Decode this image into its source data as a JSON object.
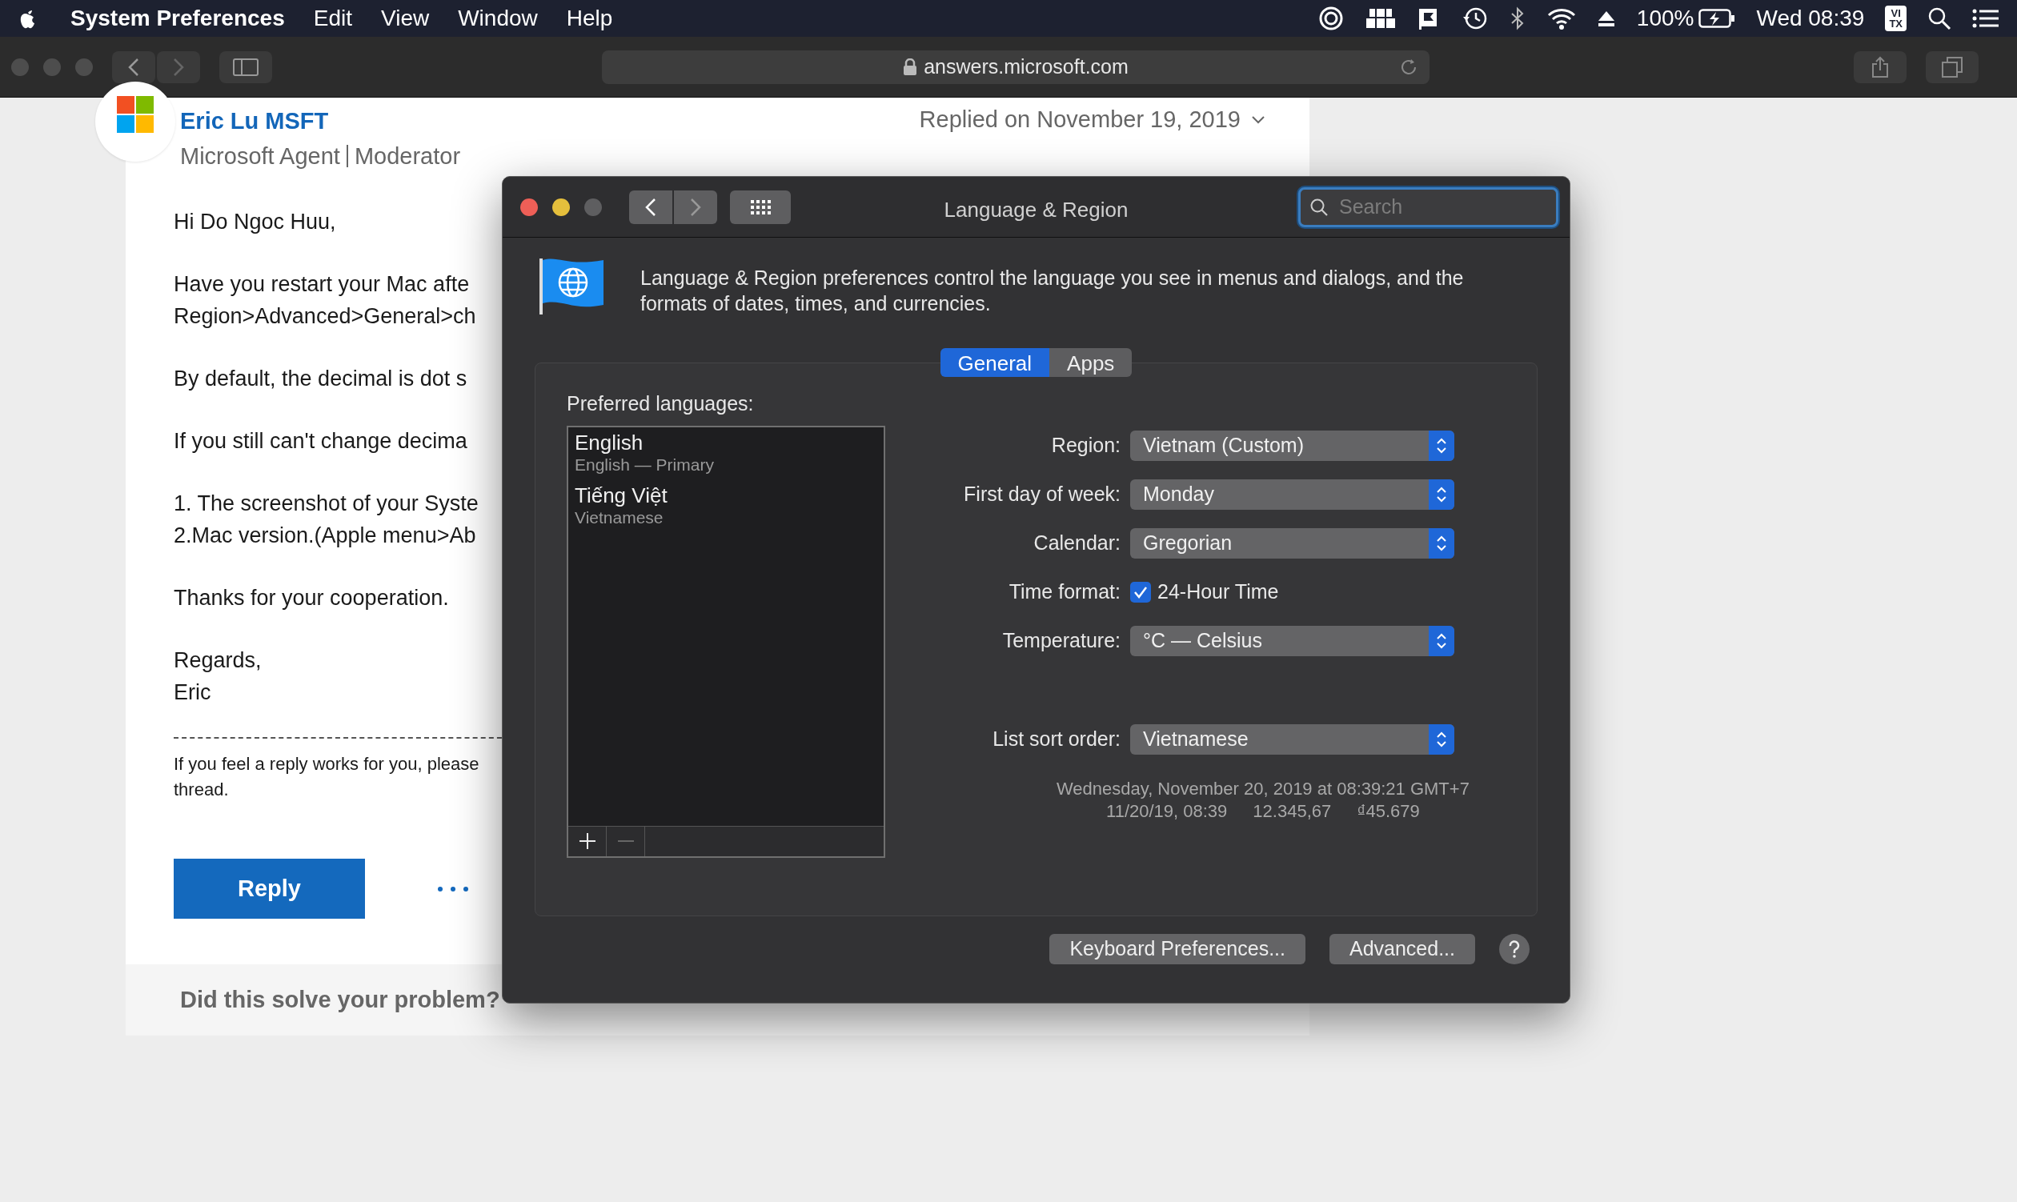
{
  "menu_bar": {
    "app": "System Preferences",
    "menus": [
      "Edit",
      "View",
      "Window",
      "Help"
    ],
    "battery": "100%",
    "clock": "Wed 08:39",
    "input_source": [
      "VI",
      "TX"
    ]
  },
  "browser": {
    "address": "answers.microsoft.com"
  },
  "post": {
    "author": "Eric Lu MSFT",
    "roles": [
      "Microsoft Agent",
      "Moderator"
    ],
    "date": "Replied on November 19, 2019",
    "paragraphs": [
      [
        "Hi Do Ngoc Huu,"
      ],
      [
        "Have you restart your Mac afte",
        "Region>Advanced>General>ch"
      ],
      [
        "By default, the decimal is dot s"
      ],
      [
        "If you still can't change decima"
      ],
      [
        "1. The screenshot of your Syste",
        "2.Mac version.(Apple menu>Ab"
      ],
      [
        "Thanks for your cooperation."
      ],
      [
        "Regards,",
        "Eric"
      ]
    ],
    "note": [
      "If you feel a reply works for you, please",
      "thread."
    ],
    "reply": "Reply",
    "feedback": "Did this solve your problem?"
  },
  "dialog": {
    "title": "Language & Region",
    "search": {
      "placeholder": "Search",
      "focused": true
    },
    "description": "Language & Region preferences control the language you see in menus and dialogs, and the formats of dates, times, and currencies.",
    "tabs": [
      {
        "label": "General",
        "selected": true
      },
      {
        "label": "Apps",
        "selected": false
      }
    ],
    "list_label": "Preferred languages:",
    "languages": [
      {
        "name": "English",
        "detail": "English — Primary"
      },
      {
        "name": "Tiếng Việt",
        "detail": "Vietnamese"
      }
    ],
    "settings": [
      {
        "kind": "popup",
        "label": "Region:",
        "value": "Vietnam (Custom)"
      },
      {
        "kind": "popup",
        "label": "First day of week:",
        "value": "Monday"
      },
      {
        "kind": "popup",
        "label": "Calendar:",
        "value": "Gregorian"
      },
      {
        "kind": "checkbox",
        "label": "Time format:",
        "value": "24-Hour Time",
        "checked": true
      },
      {
        "kind": "popup",
        "label": "Temperature:",
        "value": "°C — Celsius"
      },
      {
        "kind": "gap"
      },
      {
        "kind": "popup",
        "label": "List sort order:",
        "value": "Vietnamese"
      }
    ],
    "sample_date": "Wednesday, November 20, 2019 at 08:39:21 GMT+7",
    "samples": [
      "11/20/19, 08:39",
      "12.345,67",
      "₫45.679"
    ],
    "buttons": [
      "Keyboard Preferences...",
      "Advanced..."
    ]
  }
}
